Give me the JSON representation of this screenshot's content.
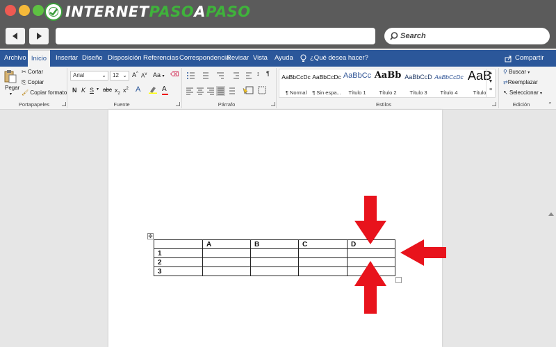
{
  "browser": {
    "logo_text_a": "INTERNET",
    "logo_text_b": "PASO",
    "logo_text_c": "A",
    "logo_text_d": "PASO",
    "search_label": "Search"
  },
  "tabs": [
    {
      "label": "Archivo"
    },
    {
      "label": "Inicio"
    },
    {
      "label": "Insertar"
    },
    {
      "label": "Diseño"
    },
    {
      "label": "Disposición"
    },
    {
      "label": "Referencias"
    },
    {
      "label": "Correspondencia"
    },
    {
      "label": "Revisar"
    },
    {
      "label": "Vista"
    },
    {
      "label": "Ayuda"
    }
  ],
  "tell_me": "¿Qué desea hacer?",
  "share": "Compartir",
  "clipboard": {
    "paste": "Pegar",
    "cut": "Cortar",
    "copy": "Copiar",
    "format_painter": "Copiar formato",
    "group": "Portapapeles"
  },
  "font": {
    "name": "Arial",
    "size": "12",
    "grow": "A",
    "shrink": "A",
    "case": "Aa",
    "bold": "N",
    "italic": "K",
    "underline": "S",
    "strike": "abc",
    "sub": "x",
    "sup": "x",
    "group": "Fuente"
  },
  "paragraph": {
    "group": "Párrafo",
    "pilcrow": "¶"
  },
  "styles": {
    "group": "Estilos",
    "items": [
      {
        "preview": "AaBbCcDc",
        "name": "¶ Normal"
      },
      {
        "preview": "AaBbCcDc",
        "name": "¶ Sin espa..."
      },
      {
        "preview": "AaBbCc",
        "name": "Título 1"
      },
      {
        "preview": "AaBb",
        "name": "Título 2"
      },
      {
        "preview": "AaBbCcD",
        "name": "Título 3"
      },
      {
        "preview": "AaBbCcDc",
        "name": "Título 4"
      },
      {
        "preview": "AaB",
        "name": "Título"
      }
    ]
  },
  "editing": {
    "find": "Buscar",
    "replace": "Reemplazar",
    "select": "Seleccionar",
    "group": "Edición"
  },
  "table": {
    "header": [
      "",
      "A",
      "B",
      "C",
      "D"
    ],
    "rows": [
      [
        "1",
        "",
        "",
        "",
        ""
      ],
      [
        "2",
        "",
        "",
        "",
        ""
      ],
      [
        "3",
        "",
        "",
        "",
        ""
      ]
    ]
  },
  "colors": {
    "ribbon_blue": "#2b579a",
    "arrow_red": "#e8131c",
    "logo_green": "#3fb33b"
  }
}
